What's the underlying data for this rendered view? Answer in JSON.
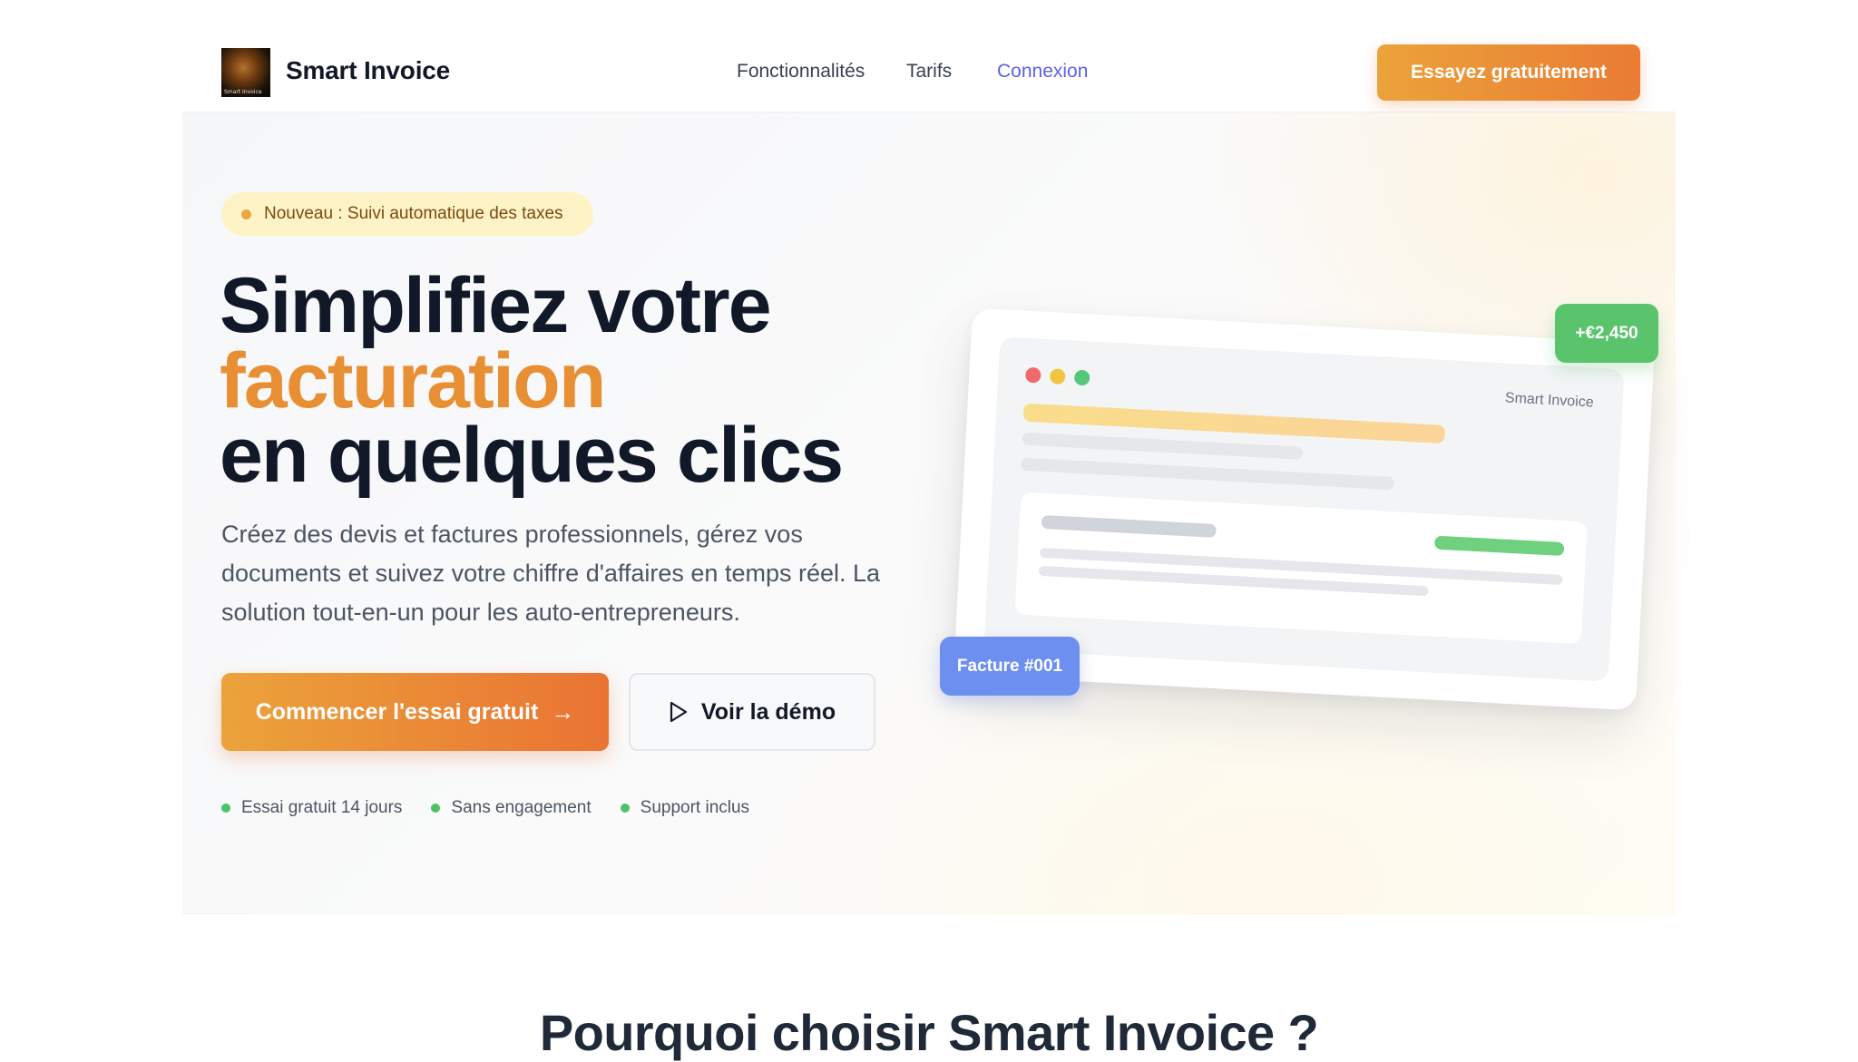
{
  "header": {
    "brand": "Smart Invoice",
    "logo_caption": "Smart Invoice",
    "nav": [
      {
        "label": "Fonctionnalités"
      },
      {
        "label": "Tarifs"
      },
      {
        "label": "Connexion"
      }
    ],
    "cta_label": "Essayez gratuitement"
  },
  "hero": {
    "badge": "Nouveau : Suivi automatique des taxes",
    "title_line1": "Simplifiez votre",
    "title_line2": "facturation",
    "title_line3": "en quelques clics",
    "lead": "Créez des devis et factures professionnels, gérez vos documents et suivez votre chiffre d'affaires en temps réel. La solution tout-en-un pour les auto-entrepreneurs.",
    "primary_button": "Commencer l'essai gratuit",
    "secondary_button": "Voir la démo",
    "features": [
      {
        "label": "Essai gratuit 14 jours"
      },
      {
        "label": "Sans engagement"
      },
      {
        "label": "Support inclus"
      }
    ]
  },
  "mockup": {
    "brand": "Smart Invoice",
    "float_amount": "+€2,450",
    "float_invoice": "Facture #001"
  },
  "next_section": {
    "heading": "Pourquoi choisir Smart Invoice ?"
  },
  "colors": {
    "accent_orange": "#ea7b34",
    "accent_yellow": "#eba33a",
    "link_indigo": "#5b63e0",
    "success_green": "#5ac46d",
    "info_blue": "#6d8ff0"
  },
  "icons": [
    "logo-image",
    "status-dot",
    "arrow-right-icon",
    "play-icon",
    "check-dot-icon"
  ]
}
